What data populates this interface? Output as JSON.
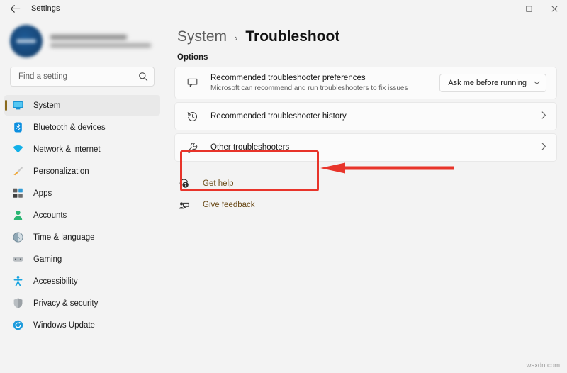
{
  "window": {
    "title": "Settings",
    "back_icon": "back-arrow-icon",
    "controls": {
      "minimize": "–",
      "maximize": "❐",
      "close": "✕"
    }
  },
  "sidebar": {
    "profile": {
      "name_redacted": "",
      "email_redacted": ""
    },
    "search": {
      "placeholder": "Find a setting",
      "value": "",
      "icon": "search-icon"
    },
    "items": [
      {
        "label": "System",
        "icon": "monitor-icon",
        "active": true
      },
      {
        "label": "Bluetooth & devices",
        "icon": "bluetooth-icon",
        "active": false
      },
      {
        "label": "Network & internet",
        "icon": "wifi-icon",
        "active": false
      },
      {
        "label": "Personalization",
        "icon": "paintbrush-icon",
        "active": false
      },
      {
        "label": "Apps",
        "icon": "apps-grid-icon",
        "active": false
      },
      {
        "label": "Accounts",
        "icon": "person-icon",
        "active": false
      },
      {
        "label": "Time & language",
        "icon": "clock-globe-icon",
        "active": false
      },
      {
        "label": "Gaming",
        "icon": "gamepad-icon",
        "active": false
      },
      {
        "label": "Accessibility",
        "icon": "accessibility-person-icon",
        "active": false
      },
      {
        "label": "Privacy & security",
        "icon": "shield-icon",
        "active": false
      },
      {
        "label": "Windows Update",
        "icon": "update-refresh-icon",
        "active": false
      }
    ]
  },
  "main": {
    "breadcrumb": {
      "parent": "System",
      "separator": "›",
      "current": "Troubleshoot"
    },
    "section_label": "Options",
    "cards": [
      {
        "title": "Recommended troubleshooter preferences",
        "subtitle": "Microsoft can recommend and run troubleshooters to fix issues",
        "icon": "speech-bubble-icon",
        "control": "dropdown",
        "dropdown_value": "Ask me before running",
        "chevron": "⌄"
      },
      {
        "title": "Recommended troubleshooter history",
        "subtitle": "",
        "icon": "history-clock-icon",
        "control": "chevron",
        "chevron": "›"
      },
      {
        "title": "Other troubleshooters",
        "subtitle": "",
        "icon": "wrench-icon",
        "control": "chevron",
        "chevron": "›"
      }
    ],
    "links": [
      {
        "label": "Get help",
        "icon": "help-question-icon"
      },
      {
        "label": "Give feedback",
        "icon": "feedback-icon"
      }
    ]
  },
  "annotation": {
    "highlight_color": "#e8342a",
    "target": "Other troubleshooters"
  },
  "watermark": "wsxdn.com"
}
